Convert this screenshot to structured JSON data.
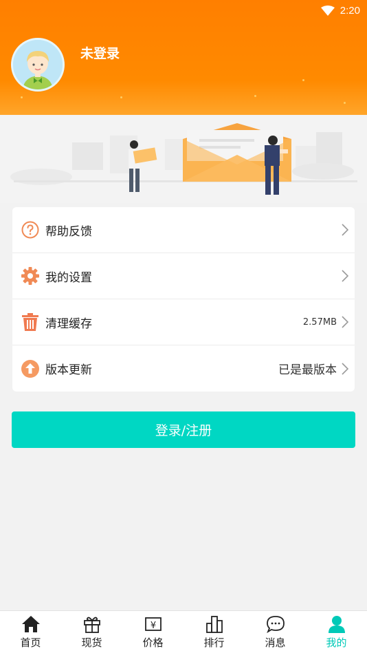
{
  "status_bar": {
    "time": "2:20"
  },
  "profile": {
    "username": "未登录"
  },
  "menu": [
    {
      "label": "帮助反馈",
      "value": "",
      "icon": "help-icon"
    },
    {
      "label": "我的设置",
      "value": "",
      "icon": "gear-icon"
    },
    {
      "label": "清理缓存",
      "value": "2.57MB",
      "icon": "trash-icon"
    },
    {
      "label": "版本更新",
      "value": "已是最版本",
      "icon": "upgrade-icon"
    }
  ],
  "login_button": {
    "label": "登录/注册"
  },
  "tabs": [
    {
      "label": "首页",
      "icon": "home-icon"
    },
    {
      "label": "现货",
      "icon": "gift-icon"
    },
    {
      "label": "价格",
      "icon": "price-icon"
    },
    {
      "label": "排行",
      "icon": "ranking-icon"
    },
    {
      "label": "消息",
      "icon": "message-icon"
    },
    {
      "label": "我的",
      "icon": "user-icon",
      "active": true
    }
  ],
  "colors": {
    "header": "#ff8000",
    "accent": "#00d7c3",
    "icon_orange": "#f08a55"
  }
}
